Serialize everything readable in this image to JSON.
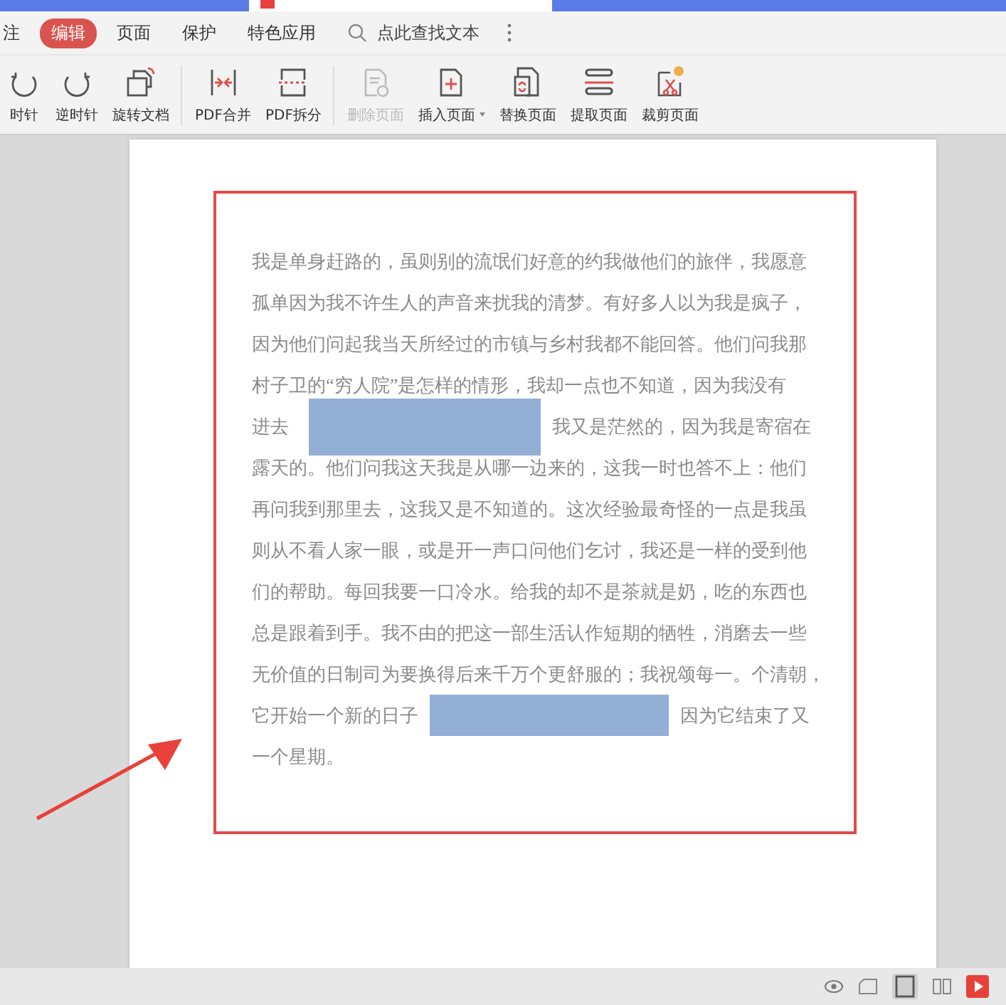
{
  "menu_tabs": [
    {
      "label": "注",
      "selected": false
    },
    {
      "label": "编辑",
      "selected": true
    },
    {
      "label": "页面",
      "selected": false
    },
    {
      "label": "保护",
      "selected": false
    },
    {
      "label": "特色应用",
      "selected": false
    }
  ],
  "search": {
    "placeholder": "点此查找文本"
  },
  "toolbar": [
    {
      "kind": "rotate-cw",
      "label": "时针",
      "disabled": false,
      "dropdown": false,
      "group_end": false
    },
    {
      "kind": "rotate-ccw",
      "label": "逆时针",
      "disabled": false,
      "dropdown": false,
      "group_end": false
    },
    {
      "kind": "rotate-doc",
      "label": "旋转文档",
      "disabled": false,
      "dropdown": false,
      "group_end": true
    },
    {
      "kind": "merge",
      "label": "PDF合并",
      "disabled": false,
      "dropdown": false,
      "group_end": false
    },
    {
      "kind": "split",
      "label": "PDF拆分",
      "disabled": false,
      "dropdown": false,
      "group_end": true
    },
    {
      "kind": "delete",
      "label": "删除页面",
      "disabled": true,
      "dropdown": false,
      "group_end": false
    },
    {
      "kind": "insert",
      "label": "插入页面",
      "disabled": false,
      "dropdown": true,
      "group_end": false
    },
    {
      "kind": "replace",
      "label": "替换页面",
      "disabled": false,
      "dropdown": false,
      "group_end": false
    },
    {
      "kind": "extract",
      "label": "提取页面",
      "disabled": false,
      "dropdown": false,
      "group_end": false
    },
    {
      "kind": "crop",
      "label": "裁剪页面",
      "disabled": false,
      "dropdown": false,
      "group_end": false
    }
  ],
  "document": {
    "lines": [
      {
        "kind": "plain",
        "text": "我是单身赶路的，虽则别的流氓们好意的约我做他们的旅伴，我愿意"
      },
      {
        "kind": "plain",
        "text": "孤单因为我不许生人的声音来扰我的清梦。有好多人以为我是疯子，"
      },
      {
        "kind": "plain",
        "text": "因为他们问起我当天所经过的市镇与乡村我都不能回答。他们问我那"
      },
      {
        "kind": "plain",
        "text": "村子卫的“穷人院”是怎样的情形，我却一点也不知道，因为我没有"
      },
      {
        "kind": "redacted",
        "before": "进去",
        "after": "我又是茫然的，因为我是寄宿在"
      },
      {
        "kind": "plain",
        "text": "露天的。他们问我这天我是从哪一边来的，这我一时也答不上：他们"
      },
      {
        "kind": "plain",
        "text": "再问我到那里去，这我又是不知道的。这次经验最奇怪的一点是我虽"
      },
      {
        "kind": "plain",
        "text": "则从不看人家一眼，或是开一声口问他们乞讨，我还是一样的受到他"
      },
      {
        "kind": "plain",
        "text": "们的帮助。每回我要一口冷水。给我的却不是茶就是奶，吃的东西也"
      },
      {
        "kind": "plain",
        "text": "总是跟着到手。我不由的把这一部生活认作短期的牺牲，消磨去一些"
      },
      {
        "kind": "plain",
        "text": "无价值的日制司为要换得后来千万个更舒服的；我祝颂每一。个清朝，"
      },
      {
        "kind": "redacted",
        "before": "它开始一个新的日子",
        "after": "因为它结束了又"
      },
      {
        "kind": "plain",
        "text": "一个星期。"
      }
    ]
  }
}
